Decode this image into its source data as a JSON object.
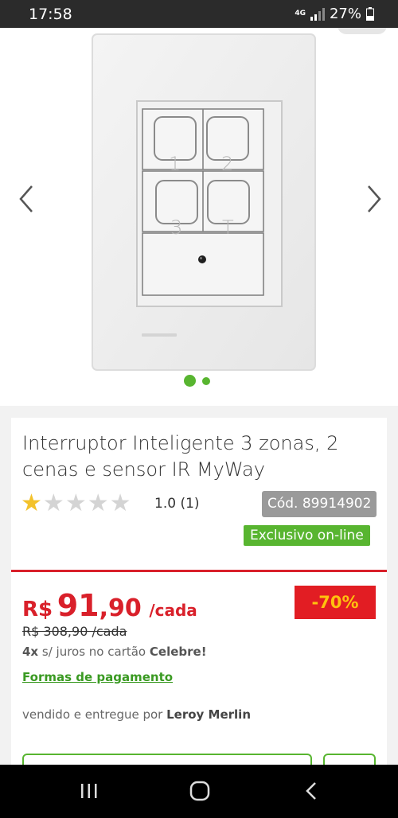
{
  "status_bar": {
    "time": "17:58",
    "network": "4G",
    "battery": "27%"
  },
  "gallery": {
    "product_image": "wall switch panel with 4 buttons labelled 1, 2, 3, T and IR sensor",
    "buttons": [
      "1",
      "2",
      "3",
      "T"
    ],
    "left_arrow_icon": "chevron-left-icon",
    "right_arrow_icon": "chevron-right-icon",
    "total_images": 2,
    "active_image": 1
  },
  "product": {
    "title": "Interruptor Inteligente 3 zonas, 2 cenas e sensor IR MyWay",
    "rating_value": 1.0,
    "rating_text": "1.0 (1)",
    "code": "Cód. 89914902",
    "exclusive_badge": "Exclusivo on-line"
  },
  "pricing": {
    "currency": "R$",
    "price_integer": "91",
    "price_decimal": ",90",
    "unit": "/cada",
    "discount": "-70%",
    "old_price": "R$ 308,90 /cada",
    "installments_prefix": "4x",
    "installments_text": " s/ juros no cartão ",
    "installments_card": "Celebre!",
    "payment_link": "Formas de pagamento"
  },
  "seller": {
    "prefix": "vendido e entregue por ",
    "name": "Leroy Merlin"
  },
  "colors": {
    "price_red": "#d9202a",
    "discount_bg": "#e21d23",
    "discount_text": "#ffc20e",
    "green": "#58b530",
    "star": "#f3c22b"
  }
}
